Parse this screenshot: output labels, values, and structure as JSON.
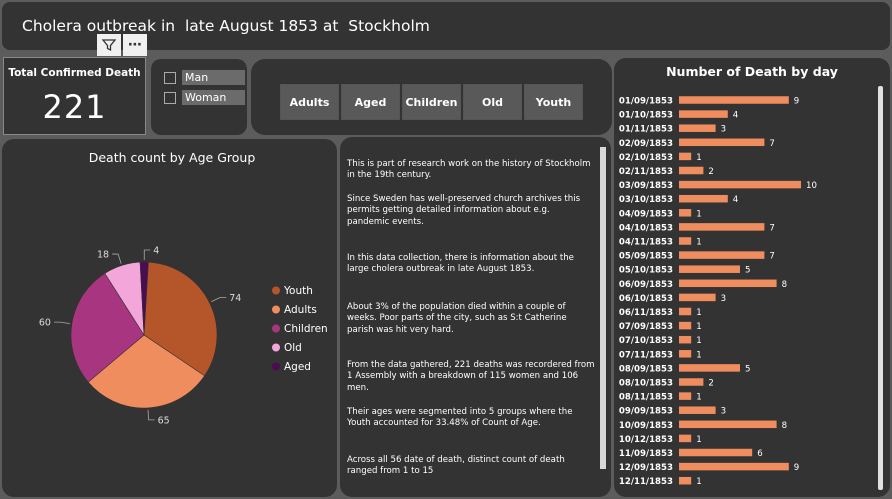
{
  "header": {
    "title": "Cholera outbreak in  late August 1853 at  Stockholm"
  },
  "header_icons": [
    {
      "name": "filter-icon",
      "glyph": "⛛"
    },
    {
      "name": "more-options-icon",
      "glyph": "⋯"
    }
  ],
  "kpi": {
    "label": "Total Confirmed Death",
    "value": "221"
  },
  "gender_filter": {
    "options": [
      "Man",
      "Woman"
    ]
  },
  "age_filter": {
    "buttons": [
      "Adults",
      "Aged",
      "Children",
      "Old",
      "Youth"
    ]
  },
  "info_text": {
    "paragraphs": [
      "This is part of research work on the history of Stockholm in the 19th century.",
      "Since Sweden has well-preserved church archives this permits getting detailed information about e.g.\npandemic events.",
      " In this data collection, there is information about the large cholera outbreak in late August 1853.",
      "About 3% of the population died within a couple of weeks. Poor parts of the city, such as S:t Catherine parish was hit very hard.",
      "From the data gathered, 221 deaths was recordered from 1 Assembly with a breakdown of 115 women and 106 men.",
      "Their  ages were  segmented into 5  groups where the Youth accounted for 33.48% of Count of  Age.",
      " Across all 56 date of death, distinct count of death ranged from 1 to 15"
    ]
  },
  "chart_data": [
    {
      "type": "pie",
      "title": "Death count  by Age Group",
      "slices": [
        {
          "label": "Youth",
          "value": 74,
          "color": "#b5562a"
        },
        {
          "label": "Adults",
          "value": 65,
          "color": "#ef8d5e"
        },
        {
          "label": "Children",
          "value": 60,
          "color": "#a8357f"
        },
        {
          "label": "Old",
          "value": 18,
          "color": "#f2a6d9"
        },
        {
          "label": "Aged",
          "value": 4,
          "color": "#4b0c52"
        }
      ],
      "legend": "right"
    },
    {
      "type": "bar",
      "orientation": "horizontal",
      "title": "Number of Death by day",
      "bar_color": "#ef8d5e",
      "categories": [
        "01/09/1853",
        "01/10/1853",
        "01/11/1853",
        "02/09/1853",
        "02/10/1853",
        "02/11/1853",
        "03/09/1853",
        "03/10/1853",
        "04/09/1853",
        "04/10/1853",
        "04/11/1853",
        "05/09/1853",
        "05/10/1853",
        "06/09/1853",
        "06/10/1853",
        "06/11/1853",
        "07/09/1853",
        "07/10/1853",
        "07/11/1853",
        "08/09/1853",
        "08/10/1853",
        "08/11/1853",
        "09/09/1853",
        "10/09/1853",
        "10/12/1853",
        "11/09/1853",
        "12/09/1853",
        "12/11/1853"
      ],
      "values": [
        9,
        4,
        3,
        7,
        1,
        2,
        10,
        4,
        1,
        7,
        1,
        7,
        5,
        8,
        3,
        1,
        1,
        1,
        1,
        5,
        2,
        1,
        3,
        8,
        1,
        6,
        9,
        1
      ]
    }
  ]
}
